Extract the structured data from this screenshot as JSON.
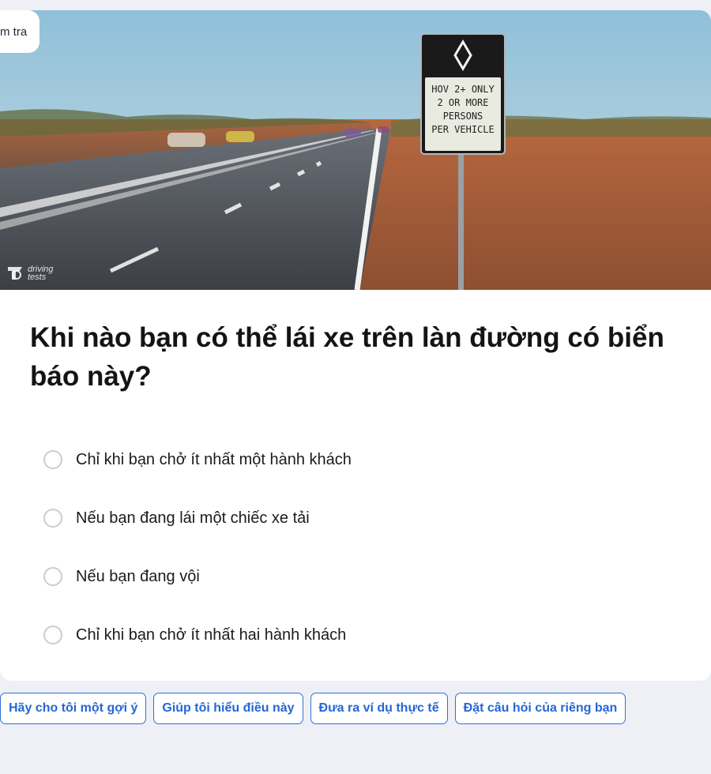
{
  "quiz": {
    "tab_chip": "m tra",
    "watermark": "driving tests",
    "sign": {
      "line1": "HOV 2+ ONLY",
      "line2": "2 OR MORE",
      "line3": "PERSONS",
      "line4": "PER VEHICLE"
    },
    "question": "Khi nào bạn có thể lái xe trên làn đường có biển báo này?",
    "answers": [
      {
        "label": "Chỉ khi bạn chở ít nhất một hành khách"
      },
      {
        "label": "Nếu bạn đang lái một chiếc xe tải"
      },
      {
        "label": "Nếu bạn đang vội"
      },
      {
        "label": "Chỉ khi bạn chở ít nhất hai hành khách"
      }
    ]
  },
  "suggestions": [
    "Hãy cho tôi một gợi ý",
    "Giúp tôi hiểu điều này",
    "Đưa ra ví dụ thực tế",
    "Đặt câu hỏi của riêng bạn"
  ],
  "colors": {
    "accent": "#2566d4",
    "background": "#eff0f5"
  }
}
